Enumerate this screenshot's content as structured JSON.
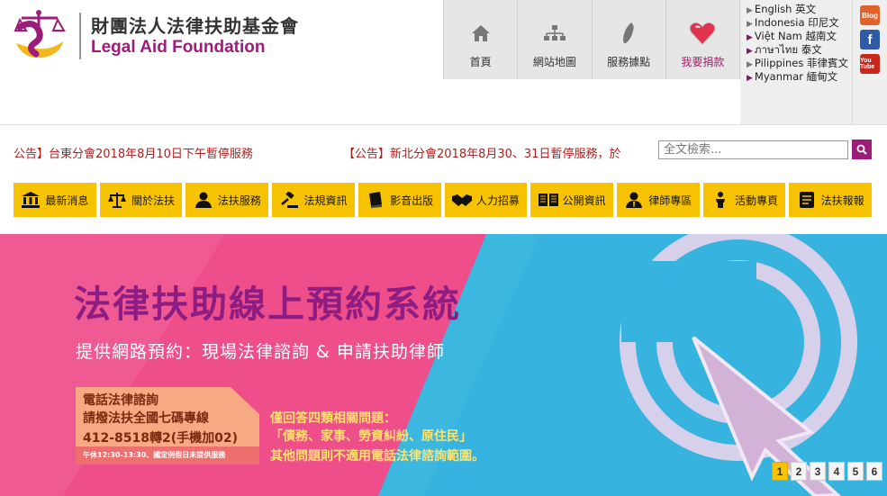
{
  "header": {
    "logo_name_zh": "財團法人法律扶助基金會",
    "logo_name_en": "Legal Aid Foundation"
  },
  "top_nav": [
    {
      "label": "首頁",
      "icon": "home-icon"
    },
    {
      "label": "網站地圖",
      "icon": "sitemap-icon"
    },
    {
      "label": "服務據點",
      "icon": "taiwan-map-icon"
    },
    {
      "label": "我要捐款",
      "icon": "heart-icon"
    }
  ],
  "languages": [
    "English 英文",
    "Indonesia 印尼文",
    "Việt Nam 越南文",
    "ภาษาไทย 泰文",
    "Pilippines 菲律賓文",
    "Myanmar 緬甸文"
  ],
  "social": {
    "blog": "Blog",
    "facebook": "f",
    "youtube": "You Tube"
  },
  "announcements": [
    "公告】台東分會2018年8月10日下午暫停服務",
    "【公告】新北分會2018年8月30、31日暫停服務，於"
  ],
  "search": {
    "placeholder": "全文檢索..."
  },
  "menu": [
    {
      "label": "最新消息",
      "icon": "building-icon"
    },
    {
      "label": "關於法扶",
      "icon": "scales-icon"
    },
    {
      "label": "法扶服務",
      "icon": "person-icon"
    },
    {
      "label": "法規資訊",
      "icon": "gavel-icon"
    },
    {
      "label": "影音出版",
      "icon": "book-icon"
    },
    {
      "label": "人力招募",
      "icon": "handshake-icon"
    },
    {
      "label": "公開資訊",
      "icon": "open-book-icon"
    },
    {
      "label": "律師專區",
      "icon": "lawyer-icon"
    },
    {
      "label": "活動專頁",
      "icon": "podium-icon"
    },
    {
      "label": "法扶報報",
      "icon": "document-icon"
    }
  ],
  "banner": {
    "title": "法律扶助線上預約系統",
    "subtitle": "提供網路預約：現場法律諮詢 & 申請扶助律師",
    "phone_line1": "電話法律諮詢",
    "phone_line2": "請撥法扶全國七碼專線",
    "phone_line3": "412-8518轉2(手機加02)",
    "phone_note": "午休12:30-13:30、國定例假日未提供服務",
    "questions_line1": "僅回答四類相關問題：",
    "questions_line2": "「債務、家事、勞資糾紛、原住民」",
    "questions_line3": "其他問題則不適用電話法律諮詢範圍。"
  },
  "pager": [
    "1",
    "2",
    "3",
    "4",
    "5",
    "6"
  ],
  "pager_active": "1",
  "colors": {
    "brand": "#9d1c79",
    "menu": "#f7c300",
    "banner_pink": "#ee4e8a",
    "banner_blue": "#36b4df",
    "announce": "#b01e1e"
  }
}
